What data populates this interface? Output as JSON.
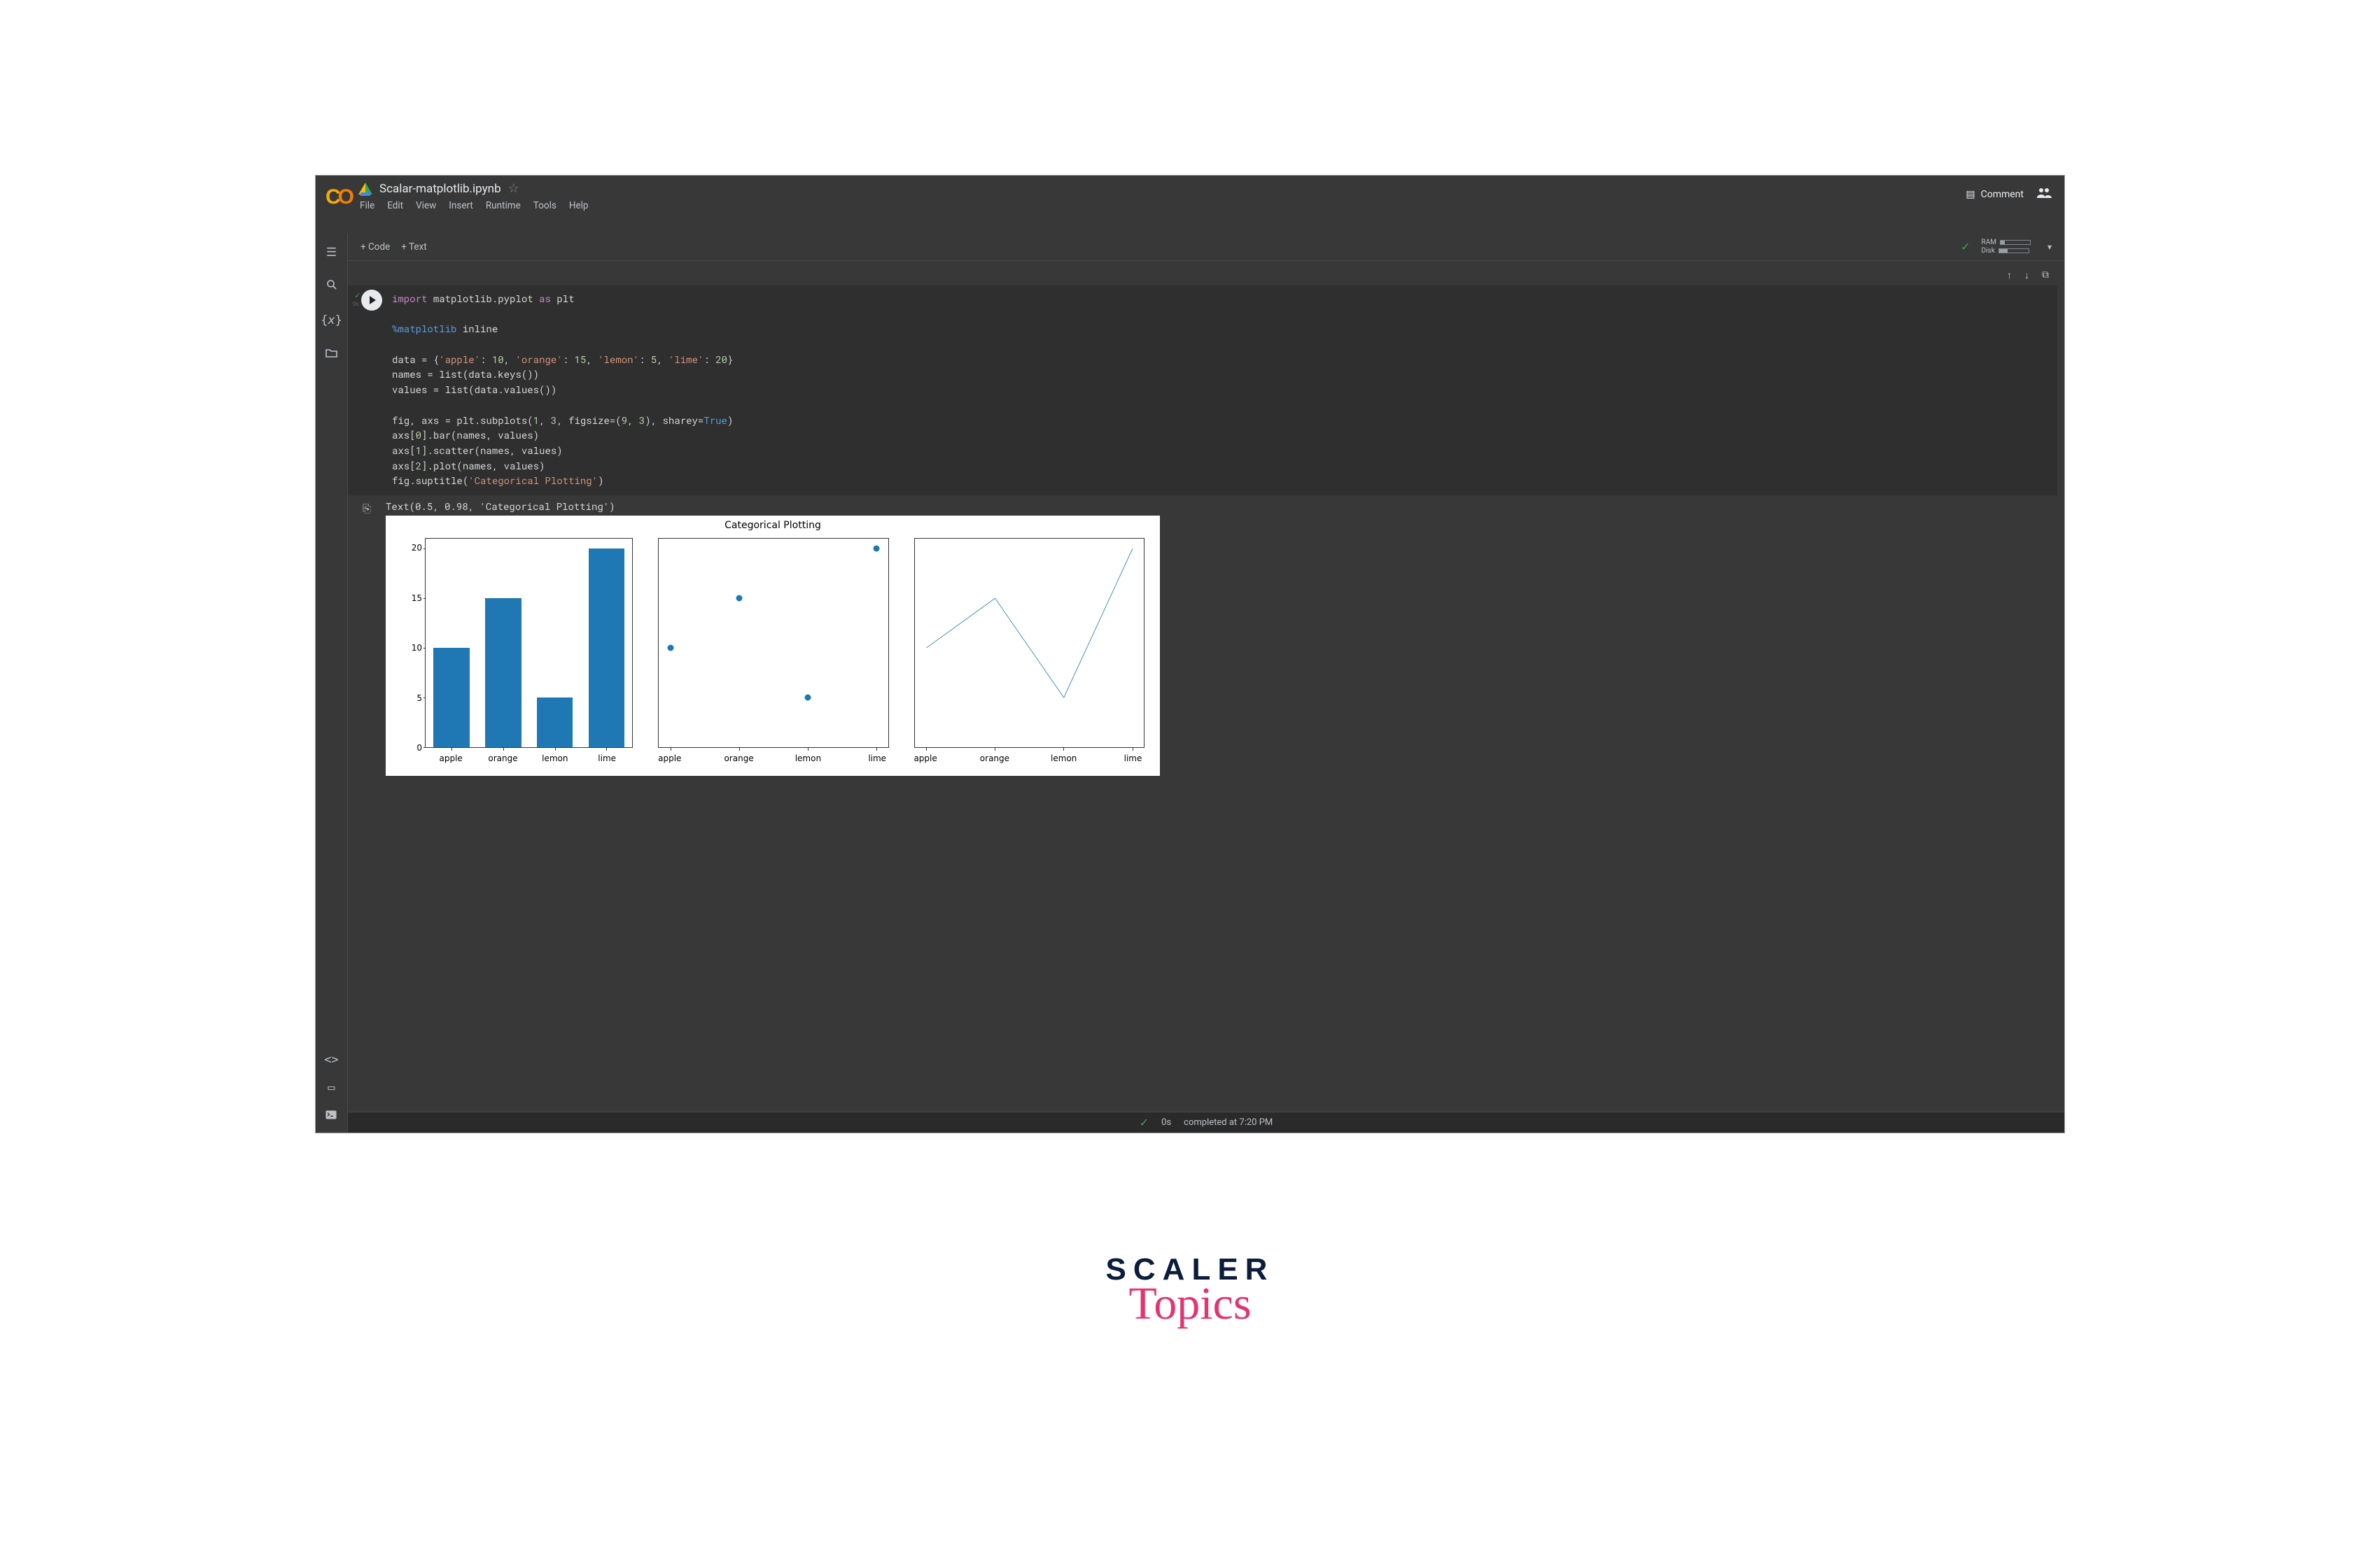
{
  "header": {
    "title": "Scalar-matplotlib.ipynb",
    "menu": [
      "File",
      "Edit",
      "View",
      "Insert",
      "Runtime",
      "Tools",
      "Help"
    ],
    "comment_label": "Comment"
  },
  "toolbar": {
    "add_code": "+ Code",
    "add_text": "+ Text",
    "ram_label": "RAM",
    "disk_label": "Disk",
    "ram_pct": 15,
    "disk_pct": 30
  },
  "code_tokens": [
    [
      {
        "t": "import ",
        "c": "kw"
      },
      {
        "t": "matplotlib.pyplot ",
        "c": "lib"
      },
      {
        "t": "as ",
        "c": "as"
      },
      {
        "t": "plt",
        "c": "lib"
      }
    ],
    [],
    [
      {
        "t": "%matplotlib ",
        "c": "mag"
      },
      {
        "t": "inline",
        "c": "lib"
      }
    ],
    [],
    [
      {
        "t": "data = {",
        "c": "lib"
      },
      {
        "t": "'apple'",
        "c": "str"
      },
      {
        "t": ": ",
        "c": "lib"
      },
      {
        "t": "10",
        "c": "num"
      },
      {
        "t": ", ",
        "c": "lib"
      },
      {
        "t": "'orange'",
        "c": "str"
      },
      {
        "t": ": ",
        "c": "lib"
      },
      {
        "t": "15",
        "c": "num"
      },
      {
        "t": ", ",
        "c": "lib"
      },
      {
        "t": "'lemon'",
        "c": "str"
      },
      {
        "t": ": ",
        "c": "lib"
      },
      {
        "t": "5",
        "c": "num"
      },
      {
        "t": ", ",
        "c": "lib"
      },
      {
        "t": "'lime'",
        "c": "str"
      },
      {
        "t": ": ",
        "c": "lib"
      },
      {
        "t": "20",
        "c": "num"
      },
      {
        "t": "}",
        "c": "lib"
      }
    ],
    [
      {
        "t": "names = ",
        "c": "lib"
      },
      {
        "t": "list",
        "c": "fn"
      },
      {
        "t": "(data.keys())",
        "c": "lib"
      }
    ],
    [
      {
        "t": "values = ",
        "c": "lib"
      },
      {
        "t": "list",
        "c": "fn"
      },
      {
        "t": "(data.values())",
        "c": "lib"
      }
    ],
    [],
    [
      {
        "t": "fig, axs = plt.subplots(",
        "c": "lib"
      },
      {
        "t": "1",
        "c": "num"
      },
      {
        "t": ", ",
        "c": "lib"
      },
      {
        "t": "3",
        "c": "num"
      },
      {
        "t": ", figsize=(",
        "c": "lib"
      },
      {
        "t": "9",
        "c": "num"
      },
      {
        "t": ", ",
        "c": "lib"
      },
      {
        "t": "3",
        "c": "num"
      },
      {
        "t": "), sharey=",
        "c": "lib"
      },
      {
        "t": "True",
        "c": "bool"
      },
      {
        "t": ")",
        "c": "lib"
      }
    ],
    [
      {
        "t": "axs[",
        "c": "lib"
      },
      {
        "t": "0",
        "c": "num"
      },
      {
        "t": "].bar(names, values)",
        "c": "lib"
      }
    ],
    [
      {
        "t": "axs[",
        "c": "lib"
      },
      {
        "t": "1",
        "c": "num"
      },
      {
        "t": "].scatter(names, values)",
        "c": "lib"
      }
    ],
    [
      {
        "t": "axs[",
        "c": "lib"
      },
      {
        "t": "2",
        "c": "num"
      },
      {
        "t": "].plot(names, values)",
        "c": "lib"
      }
    ],
    [
      {
        "t": "fig.suptitle(",
        "c": "lib"
      },
      {
        "t": "'Categorical Plotting'",
        "c": "str"
      },
      {
        "t": ")",
        "c": "lib"
      }
    ]
  ],
  "output_text": "Text(0.5, 0.98, 'Categorical Plotting')",
  "chart_data": [
    {
      "type": "bar",
      "title": "Categorical Plotting",
      "categories": [
        "apple",
        "orange",
        "lemon",
        "lime"
      ],
      "values": [
        10,
        15,
        5,
        20
      ],
      "yticks": [
        0,
        5,
        10,
        15,
        20
      ],
      "ylim": [
        0,
        21
      ]
    },
    {
      "type": "scatter",
      "categories": [
        "apple",
        "orange",
        "lemon",
        "lime"
      ],
      "values": [
        10,
        15,
        5,
        20
      ],
      "ylim": [
        0,
        21
      ]
    },
    {
      "type": "line",
      "categories": [
        "apple",
        "orange",
        "lemon",
        "lime"
      ],
      "values": [
        10,
        15,
        5,
        20
      ],
      "ylim": [
        0,
        21
      ]
    }
  ],
  "status": {
    "duration": "0s",
    "message": "completed at 7:20 PM"
  },
  "branding": {
    "top": "SCALER",
    "bottom": "Topics"
  }
}
